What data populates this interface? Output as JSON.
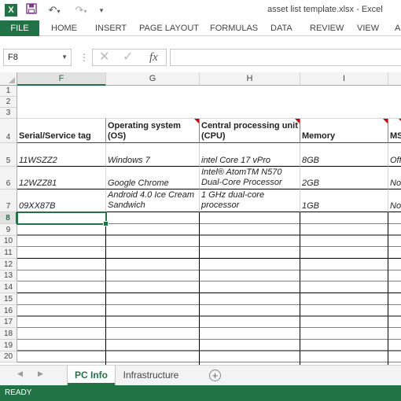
{
  "app": {
    "logo": "X",
    "title": "asset list template.xlsx - Excel",
    "qat": {
      "save_icon": "floppy-disk-icon",
      "undo_icon": "undo-icon",
      "redo_icon": "redo-icon"
    }
  },
  "ribbon": {
    "tabs": [
      "FILE",
      "HOME",
      "INSERT",
      "PAGE LAYOUT",
      "FORMULAS",
      "DATA",
      "REVIEW",
      "VIEW",
      "A"
    ]
  },
  "formula_bar": {
    "name_box": "F8",
    "fx_label": "fx",
    "content": ""
  },
  "sheet": {
    "columns": [
      "F",
      "G",
      "H",
      "I",
      ""
    ],
    "rows": [
      "1",
      "2",
      "3",
      "4",
      "5",
      "6",
      "7",
      "8",
      "9",
      "10",
      "11",
      "12",
      "13",
      "14",
      "15",
      "16",
      "17",
      "18",
      "19",
      "20"
    ],
    "headers": [
      "Serial/Service tag",
      "Operating system (OS)",
      "Central processing unit (CPU)",
      "Memory",
      "MS"
    ],
    "data": [
      [
        "11WSZZ2",
        "Windows 7",
        "intel Core 17 vPro",
        "8GB",
        "Offi"
      ],
      [
        "12WZZ81",
        "Google Chrome",
        "Intel® AtomTM N570 Dual-Core Processor",
        "2GB",
        "No"
      ],
      [
        "09XX87B",
        "Android 4.0 Ice Cream Sandwich",
        "1 GHz dual-core processor",
        "1GB",
        "No"
      ]
    ],
    "active_cell": "F8"
  },
  "sheet_tabs": {
    "tabs": [
      "PC Info",
      "Infrastructure"
    ],
    "active": "PC Info",
    "add_label": "+"
  },
  "status": "READY",
  "colors": {
    "accent": "#217346",
    "comment_marker": "#cc0000"
  }
}
